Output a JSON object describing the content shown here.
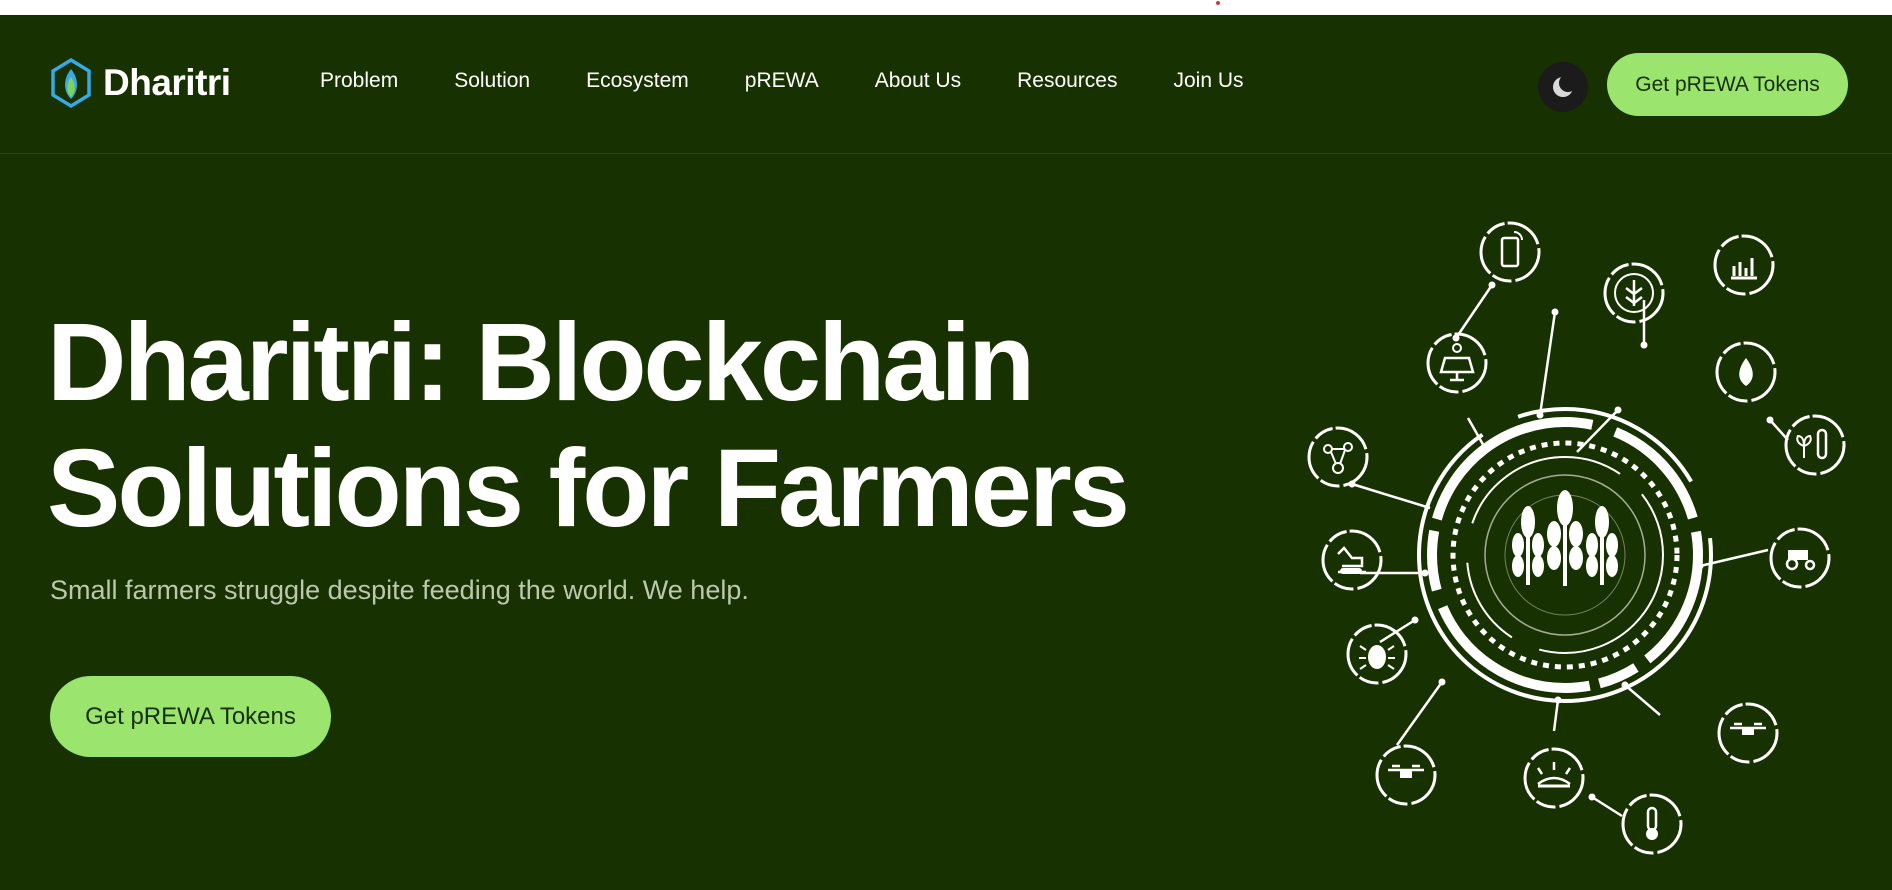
{
  "brand": {
    "name": "Dharitri"
  },
  "nav": {
    "items": [
      "Problem",
      "Solution",
      "Ecosystem",
      "pREWA",
      "About Us",
      "Resources",
      "Join Us"
    ],
    "cta_label": "Get pREWA Tokens",
    "theme_icon": "moon-icon"
  },
  "hero": {
    "title_line1": "Dharitri: Blockchain",
    "title_line2": "Solutions for Farmers",
    "subtitle": "Small farmers struggle despite feeding the world. We help.",
    "cta_label": "Get pREWA Tokens"
  },
  "illustration": {
    "center_icon": "wheat-icon",
    "satellite_icons": [
      "smartphone-iot-icon",
      "wheat-badge-icon",
      "bar-chart-icon",
      "solar-panel-icon",
      "water-drop-icon",
      "plant-test-tube-icon",
      "molecule-icon",
      "excavator-icon",
      "tractor-icon",
      "bug-icon",
      "drone-icon",
      "irrigation-icon",
      "drone-icon",
      "thermometer-icon"
    ]
  },
  "colors": {
    "background": "#183101",
    "accent": "#9be46e",
    "text": "#ffffff",
    "subtitle": "#b9c8ae"
  }
}
